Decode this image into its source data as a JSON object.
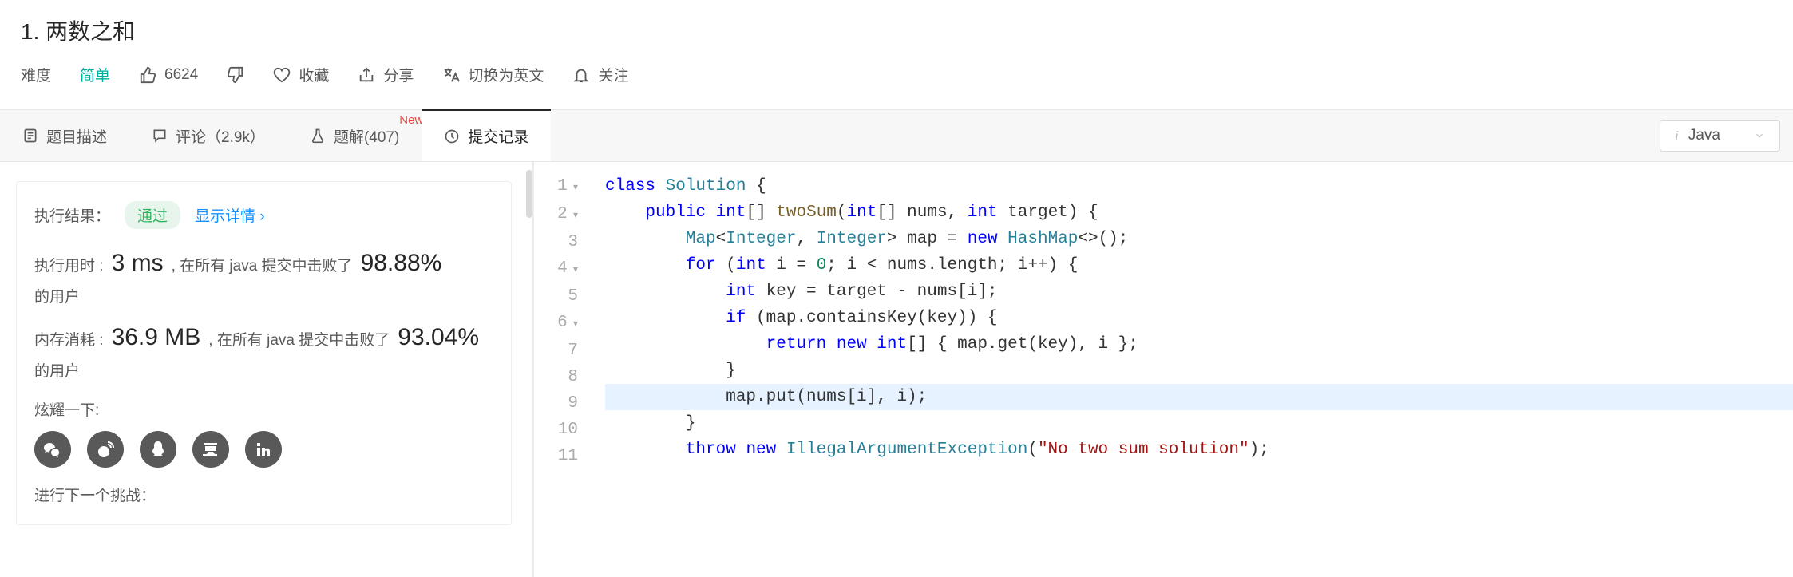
{
  "header": {
    "title": "1. 两数之和",
    "difficulty_label": "难度",
    "difficulty_value": "简单",
    "likes": "6624",
    "favorite": "收藏",
    "share": "分享",
    "switch_lang": "切换为英文",
    "follow": "关注"
  },
  "tabs": {
    "description": "题目描述",
    "comments": "评论（2.9k）",
    "solutions": "题解(407)",
    "solutions_badge": "New",
    "submissions": "提交记录"
  },
  "lang": {
    "name": "Java"
  },
  "result": {
    "exec_label": "执行结果：",
    "status": "通过",
    "show_detail": "显示详情 ›",
    "runtime_label": "执行用时 :",
    "runtime_value": "3 ms",
    "runtime_desc_prefix": ", 在所有 java 提交中击败了",
    "runtime_pct": "98.88%",
    "runtime_desc_suffix": "的用户",
    "memory_label": "内存消耗 :",
    "memory_value": "36.9 MB",
    "memory_desc_prefix": ", 在所有 java 提交中击败了",
    "memory_pct": "93.04%",
    "memory_desc_suffix": "的用户",
    "brag": "炫耀一下:",
    "next": "进行下一个挑战："
  },
  "code_lines": [
    {
      "n": "1",
      "fold": true
    },
    {
      "n": "2",
      "fold": true
    },
    {
      "n": "3",
      "fold": false
    },
    {
      "n": "4",
      "fold": true
    },
    {
      "n": "5",
      "fold": false
    },
    {
      "n": "6",
      "fold": true
    },
    {
      "n": "7",
      "fold": false
    },
    {
      "n": "8",
      "fold": false
    },
    {
      "n": "9",
      "fold": false
    },
    {
      "n": "10",
      "fold": false
    },
    {
      "n": "11",
      "fold": false
    }
  ]
}
